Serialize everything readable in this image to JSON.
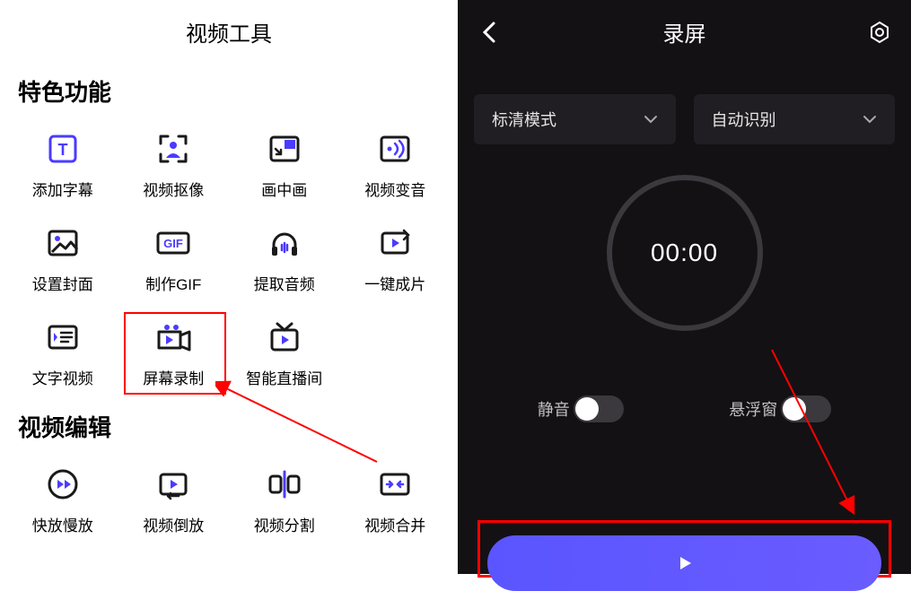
{
  "left": {
    "title": "视频工具",
    "section1": "特色功能",
    "section2": "视频编辑",
    "tools1": [
      {
        "label": "添加字幕",
        "icon": "text"
      },
      {
        "label": "视频抠像",
        "icon": "person"
      },
      {
        "label": "画中画",
        "icon": "pip"
      },
      {
        "label": "视频变音",
        "icon": "voice"
      },
      {
        "label": "设置封面",
        "icon": "image"
      },
      {
        "label": "制作GIF",
        "icon": "gif"
      },
      {
        "label": "提取音频",
        "icon": "headphones"
      },
      {
        "label": "一键成片",
        "icon": "oneclick"
      },
      {
        "label": "文字视频",
        "icon": "textvideo"
      },
      {
        "label": "屏幕录制",
        "icon": "record"
      },
      {
        "label": "智能直播间",
        "icon": "live"
      }
    ],
    "tools2": [
      {
        "label": "快放慢放",
        "icon": "speed"
      },
      {
        "label": "视频倒放",
        "icon": "reverse"
      },
      {
        "label": "视频分割",
        "icon": "split"
      },
      {
        "label": "视频合并",
        "icon": "merge"
      }
    ]
  },
  "right": {
    "title": "录屏",
    "dd1": "标清模式",
    "dd2": "自动识别",
    "timer": "00:00",
    "mute": "静音",
    "float": "悬浮窗"
  },
  "colors": {
    "accent": "#4a3bff",
    "black": "#1a1a1a"
  }
}
